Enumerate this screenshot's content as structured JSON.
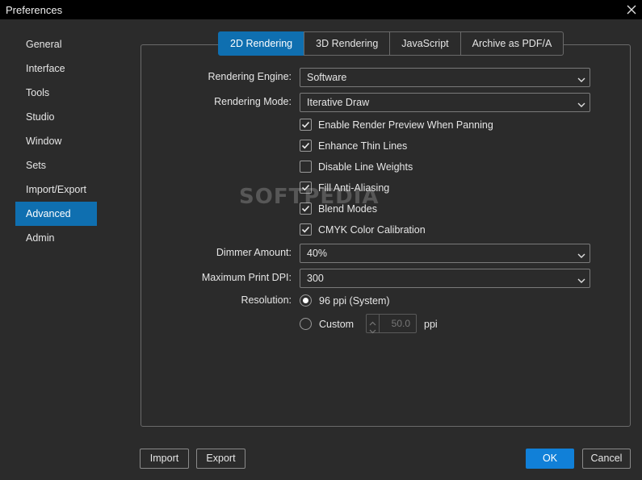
{
  "window": {
    "title": "Preferences"
  },
  "sidebar": {
    "items": [
      {
        "label": "General"
      },
      {
        "label": "Interface"
      },
      {
        "label": "Tools"
      },
      {
        "label": "Studio"
      },
      {
        "label": "Window"
      },
      {
        "label": "Sets"
      },
      {
        "label": "Import/Export"
      },
      {
        "label": "Advanced",
        "active": true
      },
      {
        "label": "Admin"
      }
    ]
  },
  "tabs": [
    {
      "label": "2D Rendering",
      "active": true
    },
    {
      "label": "3D Rendering"
    },
    {
      "label": "JavaScript"
    },
    {
      "label": "Archive as PDF/A"
    }
  ],
  "settings": {
    "rendering_engine": {
      "label": "Rendering Engine:",
      "value": "Software"
    },
    "rendering_mode": {
      "label": "Rendering Mode:",
      "value": "Iterative Draw"
    },
    "checkboxes": [
      {
        "label": "Enable Render Preview When Panning",
        "checked": true
      },
      {
        "label": "Enhance Thin Lines",
        "checked": true
      },
      {
        "label": "Disable Line Weights",
        "checked": false
      },
      {
        "label": "Fill Anti-Aliasing",
        "checked": true
      },
      {
        "label": "Blend Modes",
        "checked": true
      },
      {
        "label": "CMYK Color Calibration",
        "checked": true
      }
    ],
    "dimmer_amount": {
      "label": "Dimmer Amount:",
      "value": "40%"
    },
    "max_print_dpi": {
      "label": "Maximum Print DPI:",
      "value": "300"
    },
    "resolution": {
      "label": "Resolution:",
      "options": [
        {
          "label": "96 ppi (System)",
          "selected": true
        },
        {
          "label": "Custom",
          "selected": false
        }
      ],
      "custom_value": "50.0",
      "unit": "ppi"
    }
  },
  "footer": {
    "import_label": "Import",
    "export_label": "Export",
    "ok_label": "OK",
    "cancel_label": "Cancel"
  },
  "watermark": "SOFTPEDIA",
  "colors": {
    "accent": "#0f6fb0",
    "ok_button": "#1180d8",
    "background": "#2b2b2b",
    "titlebar": "#000000"
  }
}
